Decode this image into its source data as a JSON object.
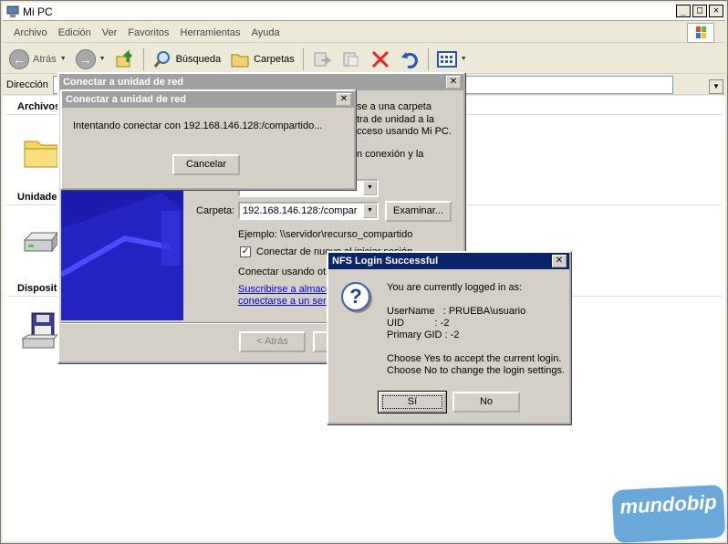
{
  "window": {
    "title": "Mi PC"
  },
  "menu": [
    "Archivo",
    "Edición",
    "Ver",
    "Favoritos",
    "Herramientas",
    "Ayuda"
  ],
  "toolbar": {
    "back": "Atrás",
    "search": "Búsqueda",
    "folders": "Carpetas"
  },
  "address": {
    "label": "Dirección",
    "go": "Ir"
  },
  "content": {
    "groups": [
      "Archivos",
      "Unidade",
      "Disposit"
    ]
  },
  "wizard": {
    "title": "Conectar a unidad de red",
    "text_partial": [
      "se a una carpeta",
      "tra de unidad a la",
      "cceso usando Mi PC.",
      "n conexión y la"
    ],
    "folder_label": "Carpeta:",
    "folder_value": "192.168.146.128:/compar",
    "browse": "Examinar...",
    "example": "Ejemplo: \\\\servidor\\recurso_compartido",
    "reconnect_label": "Conectar de nuevo al iniciar sesión",
    "connect_other": "Conectar usando ot",
    "link1": "Suscribirse a almace",
    "link2": "conectarse a un ser",
    "back_btn": "< Atrás",
    "next_btn": "F"
  },
  "progress": {
    "title": "Conectar a unidad de red",
    "message": "Intentando conectar con 192.168.146.128:/compartido...",
    "cancel": "Cancelar"
  },
  "nfs": {
    "title": "NFS Login Successful",
    "logged": "You are currently logged in as:",
    "username": "UserName   : PRUEBA\\usuario",
    "uid": "UID           : -2",
    "gid": "Primary GID : -2",
    "yes_hint": "Choose Yes to accept the current login.",
    "no_hint": "Choose No to change the login settings.",
    "yes": "Sí",
    "no": "No"
  },
  "watermark": "mundobip"
}
